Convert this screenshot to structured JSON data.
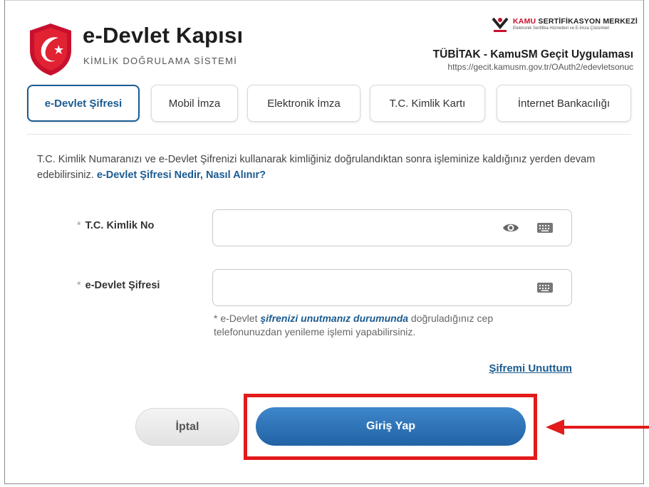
{
  "header": {
    "brand_title": "e-Devlet Kapısı",
    "brand_subtitle": "KİMLİK DOĞRULAMA SİSTEMİ",
    "kamusm_prefix": "KAMU",
    "kamusm_name": "SERTİFİKASYON MERKEZİ",
    "kamusm_tagline": "Elektronik Sertifika Hizmetleri ve E-İmza Çözümleri",
    "app_title": "TÜBİTAK - KamuSM Geçit Uygulaması",
    "app_url": "https://gecit.kamusm.gov.tr/OAuth2/edevletsonuc"
  },
  "tabs": [
    {
      "label": "e-Devlet Şifresi",
      "active": true
    },
    {
      "label": "Mobil İmza",
      "active": false
    },
    {
      "label": "Elektronik İmza",
      "active": false
    },
    {
      "label": "T.C. Kimlik Kartı",
      "active": false
    },
    {
      "label": "İnternet Bankacılığı",
      "active": false
    }
  ],
  "intro": {
    "text": "T.C. Kimlik Numaranızı ve e-Devlet Şifrenizi kullanarak kimliğiniz doğrulandıktan sonra işleminize kaldığınız yerden devam edebilirsiniz.",
    "link": "e-Devlet Şifresi Nedir, Nasıl Alınır?"
  },
  "form": {
    "tc_label": "T.C. Kimlik No",
    "tc_value": "",
    "password_label": "e-Devlet Şifresi",
    "password_value": "",
    "required_mark": "*",
    "hint_prefix": "* e-Devlet",
    "hint_link": "şifrenizi unutmanız durumunda",
    "hint_suffix": "doğruladığınız cep telefonunuzdan yenileme işlemi yapabilirsiniz.",
    "forgot_link": "Şifremi Unuttum"
  },
  "actions": {
    "cancel_label": "İptal",
    "login_label": "Giriş Yap"
  },
  "colors": {
    "primary": "#1b5b91",
    "login_button": "#2b6fb4",
    "highlight": "#e21b1b"
  },
  "icons": [
    "edevlet-emblem-icon",
    "kamusm-logo-icon",
    "eye-icon",
    "keyboard-icon",
    "arrow-left-icon"
  ]
}
